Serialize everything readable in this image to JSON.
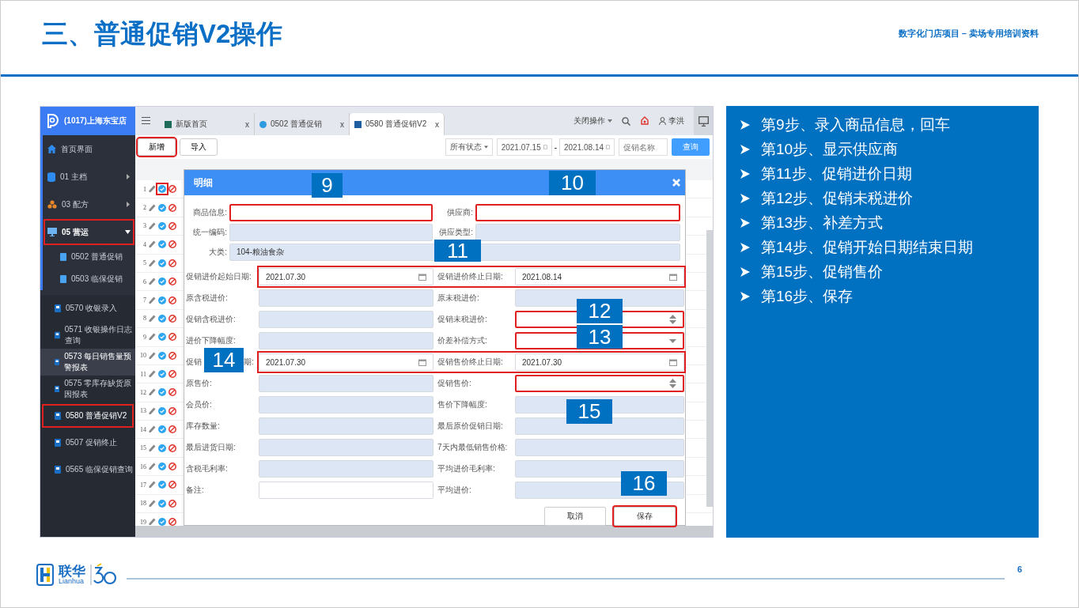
{
  "slide": {
    "title": "三、普通促销V2操作",
    "subtitle": "数字化门店项目 – 卖场专用培训资料",
    "page_number": "6"
  },
  "app": {
    "store": "(1017)上海东宝店",
    "sidebar": {
      "items": [
        {
          "label": "首页界面",
          "highlighted": false
        },
        {
          "label": "01 主档",
          "expanded": false,
          "highlighted": false
        },
        {
          "label": "03 配方",
          "expanded": false,
          "highlighted": false
        },
        {
          "label": "05 营运",
          "expanded": true,
          "highlighted": true,
          "children": [
            {
              "label": "0502 普通促销",
              "selected": false,
              "highlighted": false
            },
            {
              "label": "0503 临保促销",
              "selected": false,
              "highlighted": false
            }
          ]
        }
      ],
      "more_items": [
        {
          "label": "0570 收银录入",
          "selected": false,
          "highlighted": false
        },
        {
          "label": "0571 收银操作日志查询",
          "selected": false,
          "highlighted": false
        },
        {
          "label": "0573 每日销售量预警报表",
          "selected": true,
          "highlighted": false
        },
        {
          "label": "0575 零库存缺货原因报表",
          "selected": false,
          "highlighted": false
        },
        {
          "label": "0580 普通促销V2",
          "selected": false,
          "highlighted": true
        },
        {
          "label": "0507 促销终止",
          "selected": false,
          "highlighted": false
        },
        {
          "label": "0565 临保促销查询",
          "selected": false,
          "highlighted": false
        }
      ]
    },
    "tabs": [
      {
        "label": "新版首页",
        "selected": false,
        "close": "x"
      },
      {
        "label": "0502 普通促销",
        "selected": false,
        "close": "x"
      },
      {
        "label": "0580 普通促销V2",
        "selected": true,
        "close": "x"
      }
    ],
    "top_actions": {
      "close_menu": "关闭操作",
      "user": "李洪"
    },
    "toolbar": {
      "buttons": [
        {
          "label": "新增",
          "highlighted": true
        },
        {
          "label": "导入",
          "highlighted": false
        }
      ],
      "status": "所有状态",
      "date_from": "2021.07.15",
      "date_separator": "-",
      "date_to": "2021.08.14",
      "name_placeholder": "促销名称",
      "search": "查询"
    },
    "rows": [
      {
        "number": "1",
        "highlighted": true
      },
      {
        "number": "2",
        "highlighted": false
      },
      {
        "number": "3",
        "highlighted": false
      },
      {
        "number": "4",
        "highlighted": false
      },
      {
        "number": "5",
        "highlighted": false
      },
      {
        "number": "6",
        "highlighted": false
      },
      {
        "number": "7",
        "highlighted": false
      },
      {
        "number": "8",
        "highlighted": false
      },
      {
        "number": "9",
        "highlighted": false
      },
      {
        "number": "10",
        "highlighted": false
      },
      {
        "number": "11",
        "highlighted": false
      },
      {
        "number": "12",
        "highlighted": false
      },
      {
        "number": "13",
        "highlighted": false
      },
      {
        "number": "14",
        "highlighted": false
      },
      {
        "number": "15",
        "highlighted": false
      },
      {
        "number": "16",
        "highlighted": false
      },
      {
        "number": "17",
        "highlighted": false
      },
      {
        "number": "18",
        "highlighted": false
      },
      {
        "number": "19",
        "highlighted": false
      }
    ],
    "dialog": {
      "title": "明细",
      "header_rows": [
        {
          "left": {
            "label": "商品信息:",
            "kind": "text",
            "highlighted": true
          },
          "right": {
            "label": "供应商:",
            "kind": "text",
            "highlighted": true
          }
        },
        {
          "left": {
            "label": "统一编码:",
            "kind": "readonly",
            "highlighted": false
          },
          "right": {
            "label": "供应类型:",
            "kind": "readonly",
            "highlighted": false
          }
        },
        {
          "left": {
            "label": "大类:",
            "kind": "readonly",
            "value": "104-粮油食杂",
            "highlighted": false
          }
        }
      ],
      "rows": [
        {
          "framed": true,
          "left": {
            "label": "促销进价起始日期:",
            "kind": "date",
            "value": "2021.07.30",
            "highlighted": false
          },
          "right": {
            "label": "促销进价终止日期:",
            "kind": "date",
            "value": "2021.08.14",
            "highlighted": false
          }
        },
        {
          "left": {
            "label": "原含税进价:",
            "kind": "readonly",
            "highlighted": false
          },
          "right": {
            "label": "原未税进价:",
            "kind": "readonly",
            "highlighted": false
          }
        },
        {
          "left": {
            "label": "促销含税进价:",
            "kind": "readonly",
            "highlighted": false
          },
          "right": {
            "label": "促销未税进价:",
            "kind": "number",
            "highlighted": true
          }
        },
        {
          "left": {
            "label": "进价下降幅度:",
            "kind": "readonly",
            "highlighted": false
          },
          "right": {
            "label": "价差补偿方式:",
            "kind": "select",
            "highlighted": true
          }
        },
        {
          "framed": true,
          "left": {
            "label": "促销",
            "label_end": "期:",
            "kind": "date",
            "value": "2021.07.30",
            "highlighted": false
          },
          "right": {
            "label": "促销售价终止日期:",
            "kind": "date",
            "value": "2021.07.30",
            "highlighted": false
          }
        },
        {
          "left": {
            "label": "原售价:",
            "kind": "readonly",
            "highlighted": false
          },
          "right": {
            "label": "促销售价:",
            "kind": "number",
            "highlighted": true
          }
        },
        {
          "left": {
            "label": "会员价:",
            "kind": "readonly",
            "highlighted": false
          },
          "right": {
            "label": "售价下降幅度:",
            "kind": "readonly",
            "highlighted": false
          }
        },
        {
          "left": {
            "label": "库存数量:",
            "kind": "readonly",
            "highlighted": false
          },
          "right": {
            "label": "最后原价促销日期:",
            "kind": "readonly",
            "highlighted": false
          }
        },
        {
          "left": {
            "label": "最后进货日期:",
            "kind": "readonly",
            "highlighted": false
          },
          "right": {
            "label": "7天内最低销售价格:",
            "kind": "readonly",
            "highlighted": false
          }
        },
        {
          "left": {
            "label": "含税毛利率:",
            "kind": "readonly",
            "highlighted": false
          },
          "right": {
            "label": "平均进价毛利率:",
            "kind": "readonly",
            "highlighted": false
          }
        },
        {
          "left": {
            "label": "备注:",
            "kind": "text",
            "highlighted": false
          },
          "right": {
            "label": "平均进价:",
            "kind": "readonly",
            "highlighted": false
          }
        }
      ],
      "buttons": [
        {
          "label": "取消",
          "highlighted": false
        },
        {
          "label": "保存",
          "highlighted": true
        }
      ]
    }
  },
  "callouts": [
    "9",
    "10",
    "11",
    "12",
    "13",
    "14",
    "15",
    "16"
  ],
  "steps": [
    "第9步、录入商品信息，回车",
    "第10步、显示供应商",
    "第11步、促销进价日期",
    "第12步、促销未税进价",
    "第13步、补差方式",
    "第14步、促销开始日期结束日期",
    "第15步、促销售价",
    "第16步、保存"
  ],
  "footer": {
    "brand": "联华",
    "brand_latin": "Lianhua"
  }
}
